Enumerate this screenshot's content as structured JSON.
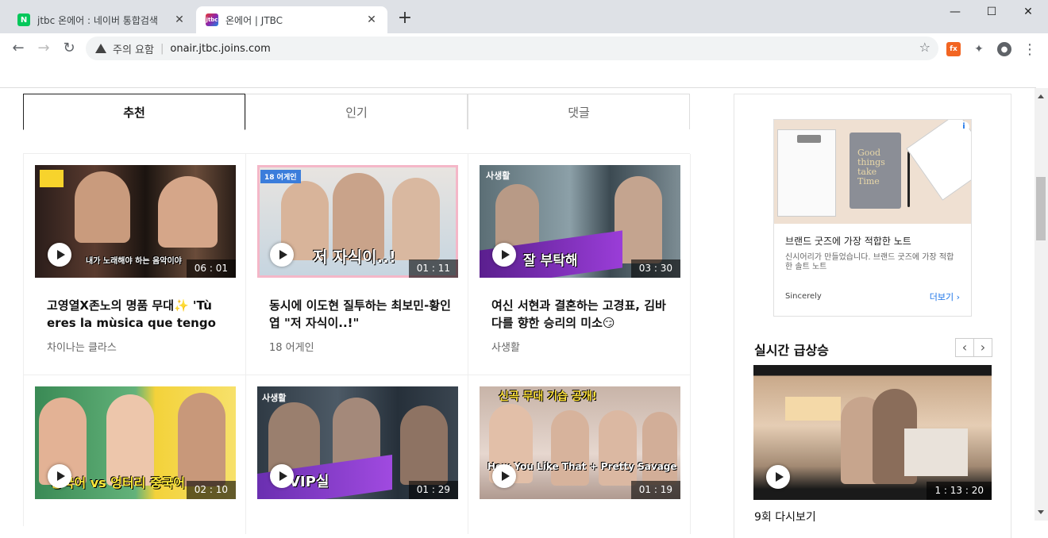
{
  "browser": {
    "tabs": [
      {
        "title": "jtbc 온에어 : 네이버 통합검색",
        "favicon": "N",
        "active": false
      },
      {
        "title": "온에어 | JTBC",
        "favicon": "jtbc",
        "active": true
      }
    ],
    "new_tab": "+",
    "window_controls": {
      "minimize": "—",
      "maximize": "☐",
      "close": "✕"
    },
    "nav": {
      "back": "←",
      "forward": "→",
      "reload": "↻"
    },
    "address": {
      "warning": "주의 요함",
      "separator": "|",
      "url": "onair.jtbc.joins.com"
    },
    "extensions": {
      "fx": "fx",
      "puzzle": "✦",
      "profile": "●",
      "menu": "⋮",
      "star": "☆"
    }
  },
  "content_tabs": [
    {
      "label": "추천",
      "selected": true
    },
    {
      "label": "인기",
      "selected": false
    },
    {
      "label": "댓글",
      "selected": false
    }
  ],
  "cards": [
    {
      "title": "고영열X존노의 명품 무대✨ 'Tù eres la mùsica que tengo que",
      "subtitle": "차이나는 클라스",
      "duration": "06 : 01",
      "overlay": "내가 노래해야 하는 음악이야"
    },
    {
      "title": "동시에 이도현 질투하는 최보민-황인엽 \"저 자식이..!\"",
      "subtitle": "18 어게인",
      "duration": "01 : 11",
      "overlay": "저 자식이..!",
      "badge": "18 어게인"
    },
    {
      "title": "여신 서현과 결혼하는 고경표, 김바다를 향한 승리의 미소😏",
      "subtitle": "사생활",
      "duration": "03 : 30",
      "overlay": "잘 부탁해",
      "badge": "사생활"
    },
    {
      "title": "",
      "subtitle": "",
      "duration": "02 : 10",
      "overlay": "중국어 vs 엉터리 중국어"
    },
    {
      "title": "",
      "subtitle": "",
      "duration": "01 : 29",
      "overlay": "VIP실",
      "badge": "사생활"
    },
    {
      "title": "",
      "subtitle": "",
      "duration": "01 : 19",
      "overlay": "How You Like That + Pretty Savage",
      "badge": "신곡 무대 기습 공개!"
    }
  ],
  "ad": {
    "title": "브랜드 굿즈에 가장 적합한 노트",
    "description": "신시어리가 만들었습니다. 브랜드 굿즈에 가장 적합한 솔트 노트",
    "brand": "Sincerely",
    "more": "더보기",
    "book_text": "Good things take Time",
    "badge": "i"
  },
  "realtime": {
    "title": "실시간 급상승",
    "prev": "‹",
    "next": "›",
    "duration": "1 : 13 : 20",
    "caption": "9회 다시보기"
  },
  "colors": {
    "accent": "#1a73e8",
    "tab_border": "#222222",
    "fx_ext": "#f26522"
  }
}
